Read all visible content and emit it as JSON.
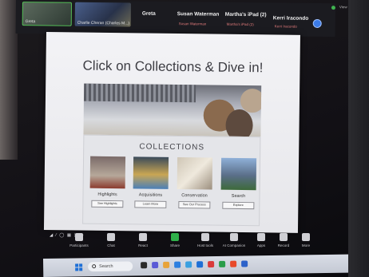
{
  "participants": [
    {
      "caption": "Greta"
    },
    {
      "caption": "Charlie Cheran (Charles M...)"
    }
  ],
  "names": [
    {
      "name": "Greta",
      "sub": ""
    },
    {
      "name": "Susan Waterman",
      "sub": "Susan Waterman"
    },
    {
      "name": "Martha's iPad (2)",
      "sub": "Martha's iPad (2)"
    },
    {
      "name": "Kerri Iracondo",
      "sub": "Kerri Iracondo"
    }
  ],
  "strip_view_label": "View",
  "slide": {
    "title": "Click on Collections & Dive in!",
    "collections_heading": "COLLECTIONS",
    "cards": [
      {
        "label": "Highlights",
        "button": "See Highlights"
      },
      {
        "label": "Acquisitions",
        "button": "Learn More"
      },
      {
        "label": "Conservation",
        "button": "See Our Process"
      },
      {
        "label": "Search",
        "button": "Explore"
      }
    ]
  },
  "mini_toolbar": "◢ ⁄ ◯ ▦ ◫ ●",
  "controls": [
    {
      "label": "Participants",
      "color": "#cfcfd4"
    },
    {
      "label": "Chat",
      "color": "#cfcfd4"
    },
    {
      "label": "React",
      "color": "#cfcfd4"
    },
    {
      "label": "Share",
      "color": "#2fb04a"
    },
    {
      "label": "Host tools",
      "color": "#cfcfd4"
    },
    {
      "label": "AI Companion",
      "color": "#cfcfd4"
    },
    {
      "label": "Apps",
      "color": "#cfcfd4"
    },
    {
      "label": "Record",
      "color": "#cfcfd4"
    },
    {
      "label": "More",
      "color": "#cfcfd4"
    }
  ],
  "taskbar": {
    "search_placeholder": "Search",
    "app_colors": [
      "#2a2a2a",
      "#5b5bd6",
      "#e8a33a",
      "#2c7fe0",
      "#3aa0e0",
      "#1e6fd6",
      "#d93b3b",
      "#2a9d4a",
      "#e84a2a",
      "#2c62c9"
    ]
  },
  "colors": {
    "accent_green": "#2fb04a",
    "avatar_blue": "#3b7be8"
  }
}
